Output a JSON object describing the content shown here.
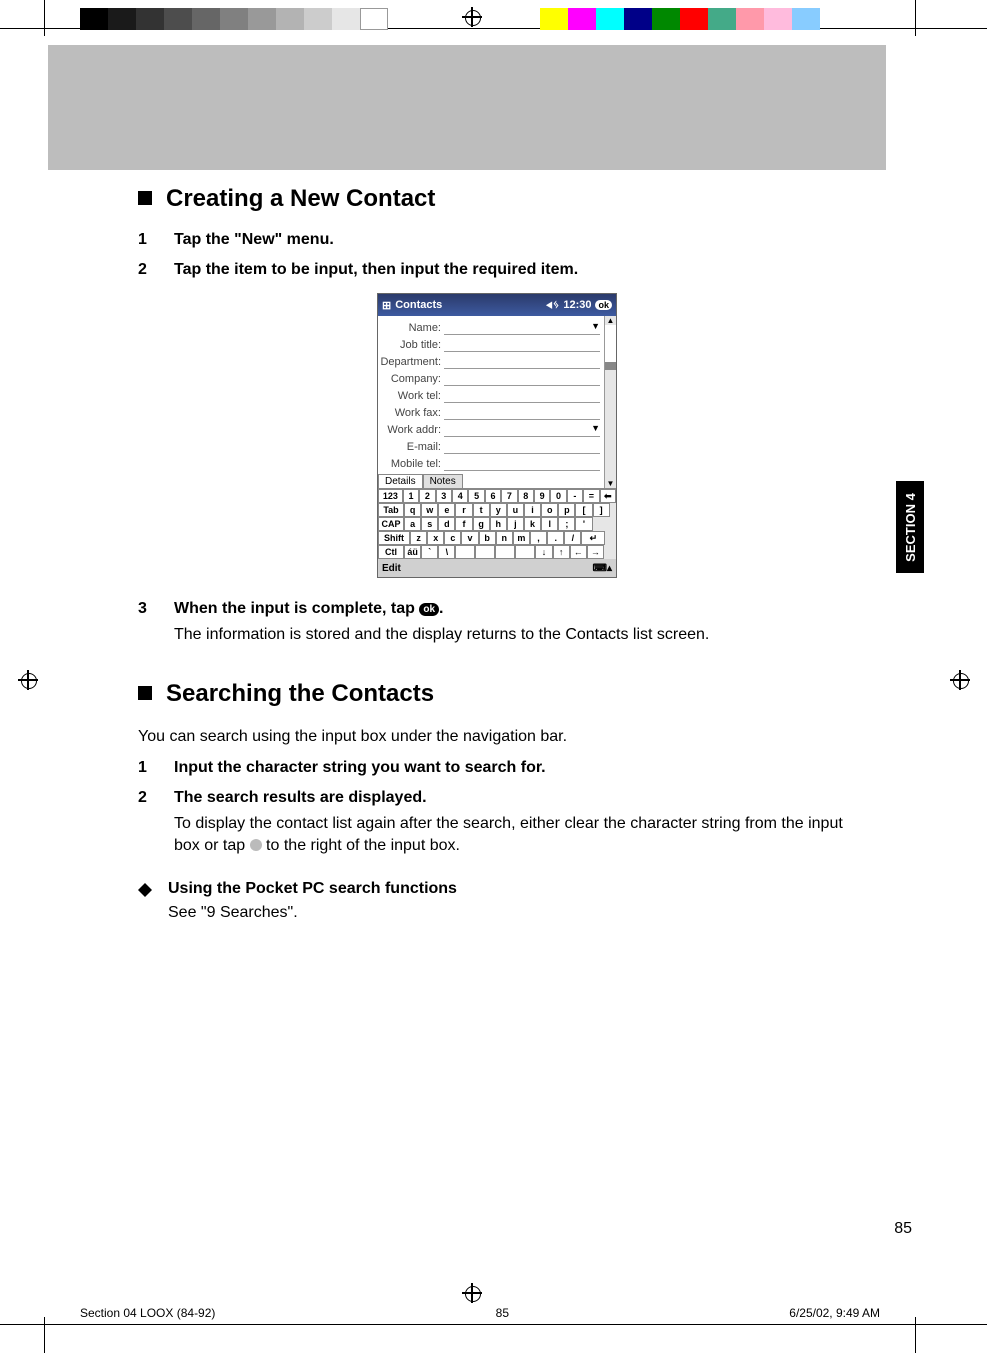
{
  "side_tab": "SECTION 4",
  "h1": "Creating a New Contact",
  "steps_a": [
    {
      "n": "1",
      "t": "Tap the \"New\" menu."
    },
    {
      "n": "2",
      "t": "Tap the item to be input, then input the required item."
    }
  ],
  "pda": {
    "title": "Contacts",
    "time": "12:30",
    "ok": "ok",
    "fields": [
      "Name:",
      "Job title:",
      "Department:",
      "Company:",
      "Work tel:",
      "Work fax:",
      "Work addr:",
      "E-mail:",
      "Mobile tel:"
    ],
    "tabs": [
      "Details",
      "Notes"
    ],
    "kb_rows": [
      [
        "123",
        "1",
        "2",
        "3",
        "4",
        "5",
        "6",
        "7",
        "8",
        "9",
        "0",
        "-",
        "=",
        "⬅"
      ],
      [
        "Tab",
        "q",
        "w",
        "e",
        "r",
        "t",
        "y",
        "u",
        "i",
        "o",
        "p",
        "[",
        "]"
      ],
      [
        "CAP",
        "a",
        "s",
        "d",
        "f",
        "g",
        "h",
        "j",
        "k",
        "l",
        ";",
        "'"
      ],
      [
        "Shift",
        "z",
        "x",
        "c",
        "v",
        "b",
        "n",
        "m",
        ",",
        ".",
        "/",
        "↵"
      ],
      [
        "Ctl",
        "áü",
        "`",
        "\\",
        " ",
        " ",
        " ",
        " ",
        "↓",
        "↑",
        "←",
        "→"
      ]
    ],
    "edit": "Edit"
  },
  "step3_n": "3",
  "step3_t_a": "When the input is complete, tap ",
  "step3_t_b": ".",
  "step3_ok": "ok",
  "step3_body": "The information is stored and the display returns to the Contacts list screen.",
  "h2": "Searching the Contacts",
  "p2": "You can search using the input box under the navigation bar.",
  "steps_b": [
    {
      "n": "1",
      "t": "Input the character string you want to search for."
    },
    {
      "n": "2",
      "t": "The search results are displayed."
    }
  ],
  "step_b2_body_a": "To display the contact list again after the search, either clear the character string from the input box or tap ",
  "step_b2_body_b": " to the right of the input box.",
  "sub_h": "Using the Pocket PC search functions",
  "sub_b": "See \"9 Searches\".",
  "page_num": "85",
  "footer": {
    "left": "Section 04 LOOX (84-92)",
    "mid": "85",
    "right": "6/25/02, 9:49 AM"
  }
}
